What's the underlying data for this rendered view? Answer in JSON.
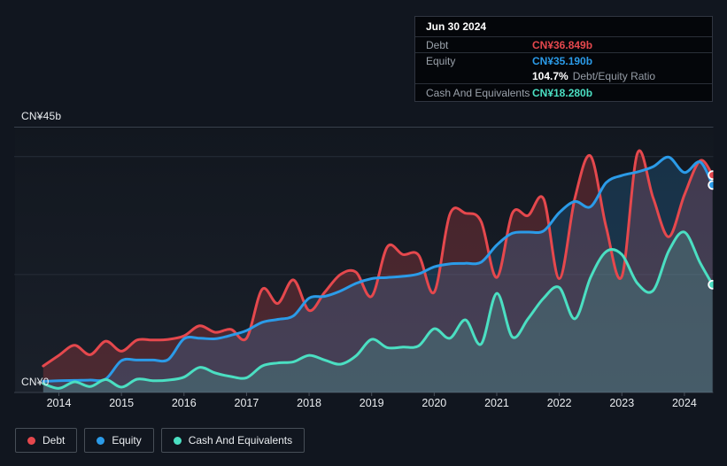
{
  "colors": {
    "debt": "#e5484d",
    "equity": "#2b9be8",
    "cash": "#4bdfc2"
  },
  "tooltip": {
    "date": "Jun 30 2024",
    "debt_label": "Debt",
    "debt_value": "CN¥36.849b",
    "equity_label": "Equity",
    "equity_value": "CN¥35.190b",
    "ratio_value": "104.7%",
    "ratio_label": "Debt/Equity Ratio",
    "cash_label": "Cash And Equivalents",
    "cash_value": "CN¥18.280b"
  },
  "legend": {
    "items": [
      {
        "id": "debt",
        "label": "Debt"
      },
      {
        "id": "equity",
        "label": "Equity"
      },
      {
        "id": "cash",
        "label": "Cash And Equivalents"
      }
    ]
  },
  "chart_data": {
    "type": "area",
    "title": "",
    "y_unit": "CN¥ billions",
    "ylim": [
      0,
      45
    ],
    "y_gridlines": [
      0,
      20,
      40,
      45
    ],
    "y_axis_labels": [
      {
        "value": 45,
        "label": "CN¥45b"
      },
      {
        "value": 0,
        "label": "CN¥0"
      }
    ],
    "x_ticks": [
      2014,
      2015,
      2016,
      2017,
      2018,
      2019,
      2020,
      2021,
      2022,
      2023,
      2024
    ],
    "legend_position": "bottom",
    "grid": true,
    "x": [
      2013.75,
      2014,
      2014.25,
      2014.5,
      2014.75,
      2015,
      2015.25,
      2015.5,
      2015.75,
      2016,
      2016.25,
      2016.5,
      2016.75,
      2017,
      2017.25,
      2017.5,
      2017.75,
      2018,
      2018.25,
      2018.5,
      2018.75,
      2019,
      2019.25,
      2019.5,
      2019.75,
      2020,
      2020.25,
      2020.5,
      2020.75,
      2021,
      2021.25,
      2021.5,
      2021.75,
      2022,
      2022.25,
      2022.5,
      2022.75,
      2023,
      2023.25,
      2023.5,
      2023.75,
      2024,
      2024.25,
      2024.45
    ],
    "series": [
      {
        "name": "Debt",
        "color": "#e5484d",
        "fill_opacity": 0.25,
        "values": [
          4.5,
          6.3,
          8.0,
          6.4,
          8.7,
          7.0,
          8.9,
          8.9,
          9.0,
          9.6,
          11.3,
          10.2,
          10.7,
          9.2,
          17.5,
          15.1,
          19.1,
          13.9,
          17.0,
          20.0,
          20.4,
          16.3,
          24.7,
          23.4,
          23.3,
          17.0,
          30.2,
          30.4,
          29.0,
          19.5,
          30.4,
          30.0,
          32.8,
          19.3,
          33.0,
          40.1,
          28.0,
          19.7,
          40.6,
          33.0,
          26.4,
          33.5,
          39.3,
          36.849
        ]
      },
      {
        "name": "Equity",
        "color": "#2b9be8",
        "fill_opacity": 0.2,
        "values": [
          1.9,
          2.0,
          2.05,
          2.1,
          2.3,
          5.4,
          5.5,
          5.5,
          5.6,
          9.1,
          9.2,
          9.1,
          9.7,
          10.5,
          11.9,
          12.4,
          13.0,
          16.0,
          16.3,
          17.2,
          18.5,
          19.3,
          19.5,
          19.7,
          20.1,
          21.3,
          21.8,
          21.9,
          22.1,
          25.0,
          27.0,
          27.2,
          27.4,
          30.5,
          32.4,
          31.5,
          35.6,
          36.8,
          37.4,
          38.3,
          39.9,
          37.3,
          39.1,
          35.19
        ]
      },
      {
        "name": "Cash And Equivalents",
        "color": "#4bdfc2",
        "fill_opacity": 0.18,
        "values": [
          1.5,
          0.7,
          1.8,
          1.0,
          2.2,
          0.9,
          2.25,
          2.0,
          2.1,
          2.6,
          4.25,
          3.3,
          2.7,
          2.5,
          4.5,
          5.0,
          5.2,
          6.3,
          5.5,
          4.8,
          6.2,
          9.0,
          7.6,
          7.7,
          7.9,
          10.8,
          9.2,
          12.3,
          8.2,
          16.8,
          9.4,
          12.5,
          16.0,
          17.8,
          12.5,
          19.5,
          23.9,
          23.4,
          18.5,
          17.3,
          24.0,
          27.2,
          22.0,
          18.28
        ]
      }
    ]
  }
}
